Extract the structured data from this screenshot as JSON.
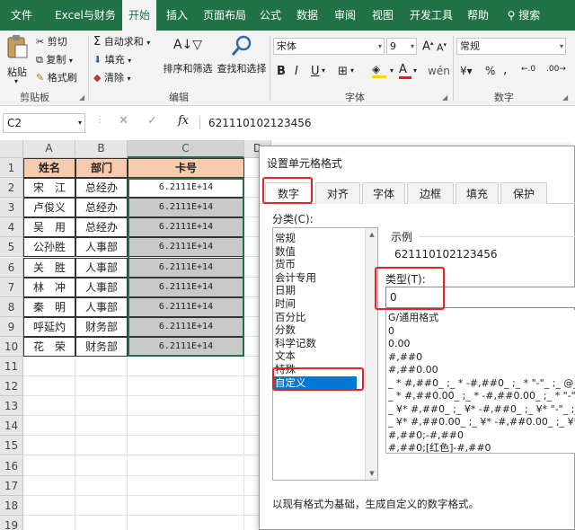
{
  "menu": {
    "items": [
      "文件",
      "Excel与财务",
      "开始",
      "插入",
      "页面布局",
      "公式",
      "数据",
      "审阅",
      "视图",
      "开发工具",
      "帮助",
      "搜索"
    ],
    "active": "开始"
  },
  "ribbon": {
    "paste": "粘贴",
    "cut": "剪切",
    "copy": "复制",
    "format_painter": "格式刷",
    "clipboard_label": "剪贴板",
    "autosum": "自动求和",
    "fill": "填充",
    "clear": "清除",
    "sort_filter": "排序和筛选",
    "find_select": "查找和选择",
    "edit_label": "编辑",
    "font_name": "宋体",
    "font_size": "9",
    "font_label": "字体",
    "bold": "B",
    "italic": "I",
    "underline": "U",
    "number_format": "常规",
    "number_label": "数字",
    "percent": "%",
    "comma": ","
  },
  "formula_bar": {
    "name_box": "C2",
    "fx": "fx",
    "value": "621110102123456"
  },
  "sheet": {
    "columns": [
      "A",
      "B",
      "C",
      "D"
    ],
    "rows": [
      "1",
      "2",
      "3",
      "4",
      "5",
      "6",
      "7",
      "8",
      "9",
      "10",
      "11",
      "12",
      "13",
      "14",
      "15",
      "16",
      "17",
      "18",
      "19"
    ],
    "headers": [
      "姓名",
      "部门",
      "卡号"
    ],
    "data": [
      [
        "宋　江",
        "总经办",
        "6.2111E+14"
      ],
      [
        "卢俊义",
        "总经办",
        "6.2111E+14"
      ],
      [
        "吴　用",
        "总经办",
        "6.2111E+14"
      ],
      [
        "公孙胜",
        "人事部",
        "6.2111E+14"
      ],
      [
        "关　胜",
        "人事部",
        "6.2111E+14"
      ],
      [
        "林　冲",
        "人事部",
        "6.2111E+14"
      ],
      [
        "秦　明",
        "人事部",
        "6.2111E+14"
      ],
      [
        "呼延灼",
        "财务部",
        "6.2111E+14"
      ],
      [
        "花　荣",
        "财务部",
        "6.2111E+14"
      ]
    ]
  },
  "dialog": {
    "title": "设置单元格格式",
    "tabs": [
      "数字",
      "对齐",
      "字体",
      "边框",
      "填充",
      "保护"
    ],
    "active_tab": "数字",
    "category_label": "分类(C):",
    "categories": [
      "常规",
      "数值",
      "货币",
      "会计专用",
      "日期",
      "时间",
      "百分比",
      "分数",
      "科学记数",
      "文本",
      "特殊",
      "自定义"
    ],
    "selected_category": "自定义",
    "sample_label": "示例",
    "sample_value": "621110102123456",
    "type_label": "类型(T):",
    "type_value": "0",
    "formats": [
      "G/通用格式",
      "0",
      "0.00",
      "#,##0",
      "#,##0.00",
      "_ * #,##0_ ;_ * -#,##0_ ;_ * \"-\"_ ;_ @_",
      "_ * #,##0.00_ ;_ * -#,##0.00_ ;_ * \"-\"??_ ;_",
      "_ ¥* #,##0_ ;_ ¥* -#,##0_ ;_ ¥* \"-\"_ ;_ @_",
      "_ ¥* #,##0.00_ ;_ ¥* -#,##0.00_ ;_ ¥* \"-\"?",
      "#,##0;-#,##0",
      "#,##0;[红色]-#,##0"
    ],
    "footer": "以现有格式为基础，生成自定义的数字格式。"
  },
  "colors": {
    "excel_green": "#217346",
    "header_fill": "#f8cbad",
    "highlight_red": "#e8202a",
    "selection_blue": "#0078d7"
  }
}
